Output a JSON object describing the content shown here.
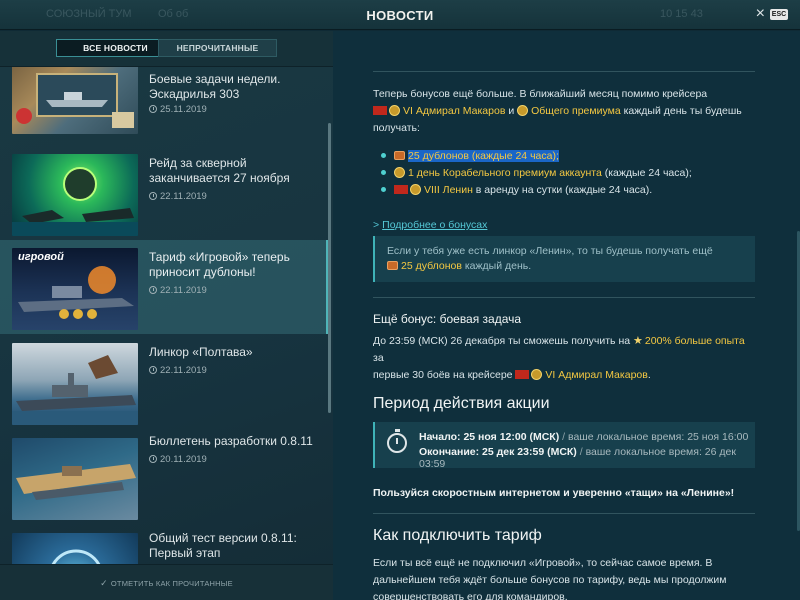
{
  "window": {
    "title": "НОВОСТИ",
    "esc_label": "ESC",
    "ghost_left": "СОЮЗНЫЙ  ТУМ",
    "ghost_mid": "Об об",
    "ghost_right": "10 15 43"
  },
  "filters": {
    "all": "ВСЕ НОВОСТИ",
    "unread": "НЕПРОЧИТАННЫЕ"
  },
  "news": [
    {
      "title": "Боевые задачи недели. Эскадрилья 303",
      "date": "25.11.2019"
    },
    {
      "title": "Рейд за скверной заканчивается 27 ноября",
      "date": "22.11.2019"
    },
    {
      "title": "Тариф «Игровой» теперь приносит дублоны!",
      "date": "22.11.2019",
      "thumb_text": "игровой"
    },
    {
      "title": "Линкор «Полтава»",
      "date": "22.11.2019"
    },
    {
      "title": "Бюллетень разработки 0.8.11",
      "date": "20.11.2019"
    },
    {
      "title": "Общий тест версии 0.8.11: Первый этап",
      "date": ""
    }
  ],
  "mark_read": "ОТМЕТИТЬ КАК ПРОЧИТАННЫЕ",
  "article": {
    "intro_a": "Теперь бонусов ещё больше. В ближайший месяц помимо крейсера",
    "ship_makarov": "VI Адмирал Макаров",
    "and": "и",
    "premium": "Общего премиума",
    "intro_b": "каждый день ты будешь",
    "intro_c": "получать:",
    "bullets": {
      "b1_gold": "25 дублонов (каждые 24 часа);",
      "b2_gold": "1 день Корабельного премиум аккаунта",
      "b2_rest": "(каждые 24 часа);",
      "b3_gold": "VIII Ленин",
      "b3_rest": "в аренду на сутки (каждые 24 часа)."
    },
    "more_link": "Подробнее о бонусах",
    "note_a": "Если у тебя уже есть линкор «Ленин», то ты будешь получать ещё",
    "note_gold": "25 дублонов",
    "note_b": "каждый день.",
    "bonus_title": "Ещё бонус: боевая задача",
    "bonus_a": "До 23:59 (МСК) 26 декабря ты сможешь получить на",
    "bonus_gold": "200% больше опыта",
    "bonus_b": "за",
    "bonus_c": "первые 30 боёв на крейсере",
    "bonus_ship": "VI Адмирал Макаров",
    "bonus_dot": ".",
    "period_title": "Период действия акции",
    "start_bold": "Начало: 25 ноя 12:00 (МСК)",
    "start_local": "ваше локальное время: 25 ноя 16:00",
    "end_bold": "Окончание: 25 дек 23:59 (МСК)",
    "end_local": "ваше локальное время: 26 дек 03:59",
    "slash": "/",
    "cta": "Пользуйся скоростным интернетом и уверенно «тащи» на «Ленине»!",
    "connect_title": "Как подключить тариф",
    "connect_a": "Если ты всё ещё не подключил «Игровой», то сейчас самое время. В",
    "connect_b": "дальнейшем тебя ждёт больше бонусов по тарифу, ведь мы продолжим",
    "connect_c": "совершенствовать его для командиров."
  },
  "colors": {
    "accent": "#4fb4b8",
    "gold": "#f4c842",
    "panel": "#0f2f3c"
  }
}
